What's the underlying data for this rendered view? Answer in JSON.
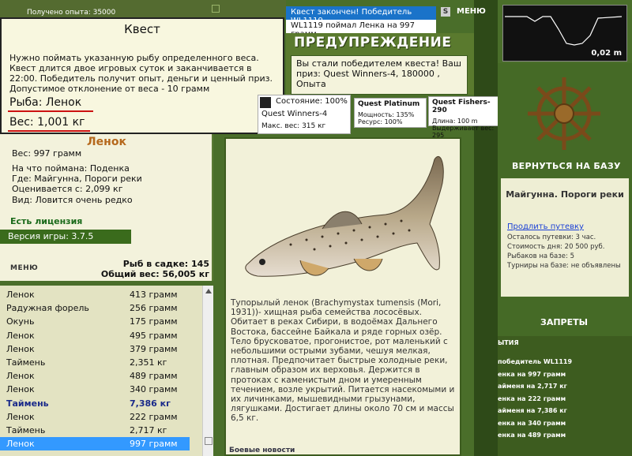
{
  "topbar": {
    "text": "Получено опыта: 35000"
  },
  "quest": {
    "title": "Квест",
    "description": "Нужно поймать указанную рыбу определенного веса. Квест длится двое игровых суток и заканчивается в 22:00. Победитель получит опыт, деньги и ценный приз. Допустимое отклонение от веса - 10 грамм",
    "fish": "Рыба: Ленок",
    "weight": "Вес: 1,001 кг"
  },
  "fish_info": {
    "name": "Ленок",
    "weight": "Вес: 997 грамм",
    "bait": "На что поймана: Поденка",
    "place": "Где: Майгунна, Пороги реки",
    "price": "Оценивается с: 2,099 кг",
    "kind": "Вид: Ловится очень редко",
    "license": "Есть лицензия"
  },
  "version": "Версия игры: 3.7.5",
  "menu_left": "МЕНЮ",
  "cage": {
    "count": "Рыб в садке: 145",
    "total": "Общий вес: 56,005 кг"
  },
  "catch_list": [
    {
      "name": "Ленок",
      "weight": "413 грамм"
    },
    {
      "name": "Радужная форель",
      "weight": "256 грамм"
    },
    {
      "name": "Окунь",
      "weight": "175 грамм"
    },
    {
      "name": "Ленок",
      "weight": "495 грамм"
    },
    {
      "name": "Ленок",
      "weight": "379 грамм"
    },
    {
      "name": "Таймень",
      "weight": "2,351 кг"
    },
    {
      "name": "Ленок",
      "weight": "489 грамм"
    },
    {
      "name": "Ленок",
      "weight": "340 грамм"
    },
    {
      "name": "Таймень",
      "weight": "7,386 кг"
    },
    {
      "name": "Ленок",
      "weight": "222 грамм"
    },
    {
      "name": "Таймень",
      "weight": "2,717 кг"
    },
    {
      "name": "Ленок",
      "weight": "997 грамм"
    }
  ],
  "fish_description": "Тупорылый ленок (Brachymystax tumensis (Mori, 1931))- хищная рыба семейства лососёвых. Обитает в реках Сибири, в водоёмах Дальнего Востока, бассейне Байкала и ряде горных озёр. Тело брусковатое, прогонистое, рот маленький с небольшими острыми зубами, чешуя мелкая, плотная. Предпочитает быстрые холодные реки, главным образом их верховья. Держится в протоках с каменистым дном и умеренным течением, возле укрытий. Питается насекомыми и их личинками, мышевидными грызунами, лягушками. Достигает длины около 70 см и массы 6,5 кг.",
  "center_bottom": "Боевые новости",
  "messages": {
    "quest_done": "Квест закончен! Победитель WL1119",
    "caught": "WL1119 поймал Ленка на 997 грамм"
  },
  "warning": {
    "title": "ПРЕДУПРЕЖДЕНИЕ",
    "text": "Вы стали победителем квеста! Ваш приз: Quest Winners-4, 180000 , Опыта"
  },
  "menu_top": "МЕНЮ",
  "status": {
    "state": "Состояние: 100%",
    "rod": "Quest Winners-4",
    "max": "Макс. вес: 315 кг"
  },
  "quest_platinum": {
    "title": "Quest Platinum",
    "power": "Мощность: 135%",
    "resource": "Ресурс: 100%"
  },
  "quest_fishers": {
    "title": "Quest Fishers-290",
    "length": "Длина: 100 m",
    "holds": "Выдерживает вес: 295"
  },
  "depth": {
    "value": "0,02 m"
  },
  "right": {
    "back": "ВЕРНУТЬСЯ НА БАЗУ",
    "location": "Майгунна. Пороги реки",
    "extend": "Продлить путевку",
    "left": "Осталось путевки: 3 час.",
    "cost": "Стоимость дня: 20 500 руб.",
    "fishers": "Рыбаков на базе: 5",
    "tournaments": "Турниры на базе: не объявлены",
    "bans": "ЗАПРЕТЫ",
    "events_title": "ЫТИЯ",
    "events": [
      "победитель WL1119",
      "енка на 997 грамм",
      "айменя на 2,717 кг",
      "енка на 222 грамм",
      "айменя на 7,386 кг",
      "енка на 340 грамм",
      "енка на 489 грамм"
    ]
  }
}
